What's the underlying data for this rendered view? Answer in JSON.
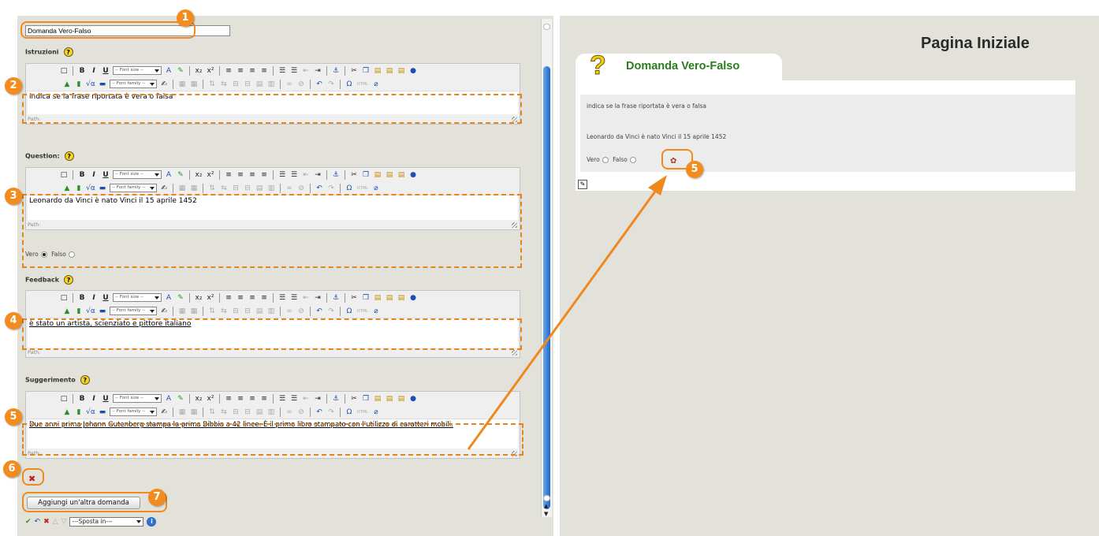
{
  "editor_panel": {
    "title_value": "Domanda Vero-Falso",
    "sections": [
      {
        "label": "Istruzioni",
        "content": "indica se la frase riportata è vera o falsa"
      },
      {
        "label": "Question:",
        "content": "Leonardo da Vinci è nato Vinci il 15 aprile 1452"
      },
      {
        "label": "Feedback",
        "content": "è stato un artista, scienziato e pittore italiano"
      },
      {
        "label": "Suggerimento",
        "content": "Due anni prima Johann Gutenberg stampa la prima Bibbia a 42 linee. È il primo libro stampato con l'utilizzo di caratteri mobili."
      }
    ],
    "path_label": "Path:",
    "font_size_select": "-- Font size --",
    "font_family_select": "-- Font family --",
    "html_label": "HTML",
    "vero_label": "Vero",
    "falso_label": "Falso",
    "add_question_button": "Aggiungi un'altra domanda",
    "move_select": "---Sposta in---",
    "help_glyph": "?"
  },
  "preview_panel": {
    "page_title": "Pagina Iniziale",
    "tab_title": "Domanda Vero-Falso",
    "instruction": "indica se la frase riportata è vera o falsa",
    "question": "Leonardo da Vinci è nato Vinci il 15 aprile 1452",
    "vero_label": "Vero",
    "falso_label": "Falso",
    "question_icon": "?"
  },
  "annotations": {
    "badges": [
      "1",
      "2",
      "3",
      "4",
      "5",
      "6",
      "7",
      "5"
    ],
    "accent_color": "#f28c1e"
  }
}
